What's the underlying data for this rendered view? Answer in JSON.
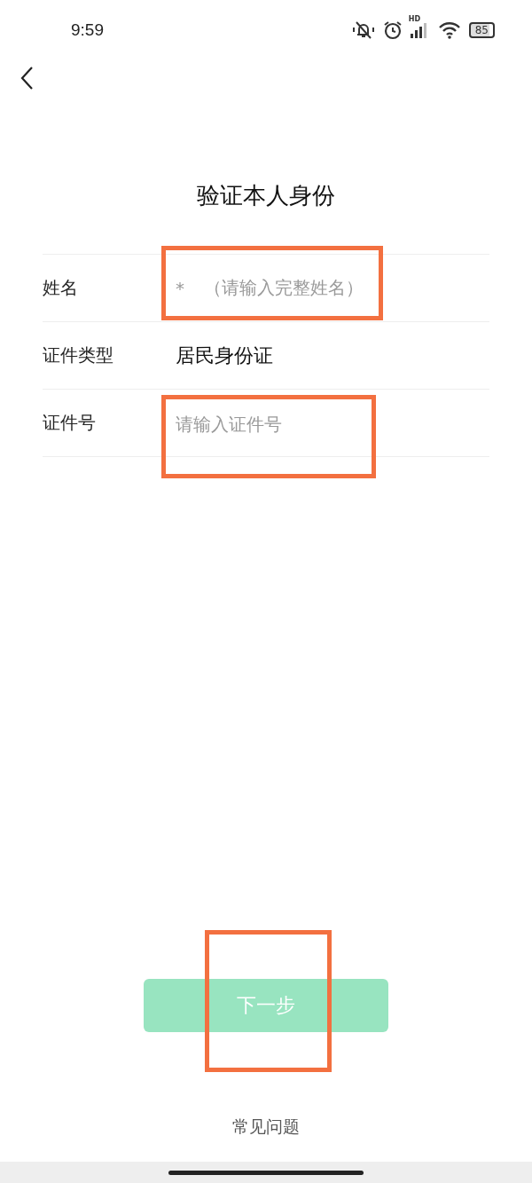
{
  "status_bar": {
    "time": "9:59",
    "network_label": "HD",
    "battery": "85"
  },
  "title": "验证本人身份",
  "form_rows": [
    {
      "label": "姓名",
      "kind": "input",
      "value": "*",
      "placeholder": "（请输入完整姓名）",
      "highlighted": true
    },
    {
      "label": "证件类型",
      "kind": "static",
      "value": "居民身份证",
      "highlighted": false
    },
    {
      "label": "证件号",
      "kind": "input",
      "placeholder": "请输入证件号",
      "highlighted": true
    }
  ],
  "next_button": {
    "label": "下一步",
    "disabled": true,
    "highlighted": true
  },
  "faq_link": "常见问题"
}
